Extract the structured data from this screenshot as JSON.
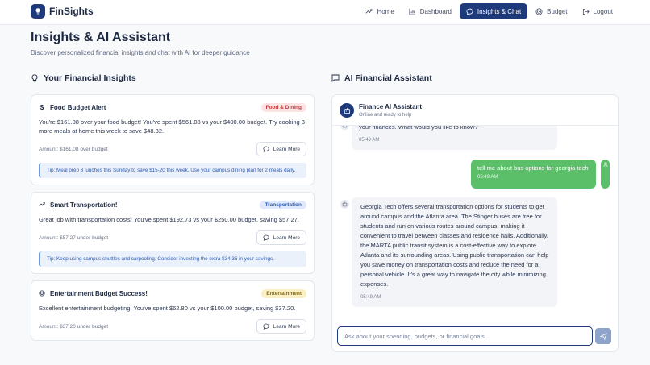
{
  "brand": {
    "name": "FinSights"
  },
  "nav": {
    "links": [
      {
        "label": "Home",
        "icon": "trend-up-icon"
      },
      {
        "label": "Dashboard",
        "icon": "bar-chart-icon"
      },
      {
        "label": "Insights & Chat",
        "icon": "chat-icon",
        "active": true
      },
      {
        "label": "Budget",
        "icon": "target-icon"
      },
      {
        "label": "Logout",
        "icon": "logout-icon"
      }
    ]
  },
  "header": {
    "title": "Insights & AI Assistant",
    "subtitle": "Discover personalized financial insights and chat with AI for deeper guidance"
  },
  "insights": {
    "title": "Your Financial Insights",
    "cards": [
      {
        "icon": "dollar-icon",
        "title": "Food Budget Alert",
        "badge": "Food & Dining",
        "badge_color": "#c23b3b",
        "text": "You're $161.08 over your food budget! You've spent $561.08 vs your $400.00 budget. Try cooking 3 more meals at home this week to save $48.32.",
        "amount": "Amount: $161.08 over budget",
        "action": "Learn More",
        "tip": "Tip: Meal prep 3 lunches this Sunday to save $15-20 this week. Use your campus dining plan for 2 meals daily."
      },
      {
        "icon": "trend-up-icon",
        "title": "Smart Transportation!",
        "badge": "Transportation",
        "badge_color": "#2f5cb3",
        "text": "Great job with transportation costs! You've spent $192.73 vs your $250.00 budget, saving $57.27.",
        "amount": "Amount: $57.27 under budget",
        "action": "Learn More",
        "tip": "Tip: Keep using campus shuttles and carpooling. Consider investing the extra $34.36 in your savings."
      },
      {
        "icon": "target-icon",
        "title": "Entertainment Budget Success!",
        "badge": "Entertainment",
        "badge_color": "#8a6b0c",
        "text": "Excellent entertainment budgeting! You've spent $62.80 vs your $100.00 budget, saving $37.20.",
        "amount": "Amount: $37.20 under budget",
        "action": "Learn More"
      }
    ]
  },
  "chat": {
    "title": "AI Financial Assistant",
    "assistant_name": "Finance AI Assistant",
    "status": "Online and ready to help",
    "messages": [
      {
        "role": "bot",
        "text": "your finances. What would you like to know?",
        "time": "05:49 AM"
      },
      {
        "role": "user",
        "text": "tell me about bus options for georgia tech",
        "time": "05:49 AM"
      },
      {
        "role": "bot",
        "text": "Georgia Tech offers several transportation options for students to get around campus and the Atlanta area. The Stinger buses are free for students and run on various routes around campus, making it convenient to travel between classes and residence halls. Additionally, the MARTA public transit system is a cost-effective way to explore Atlanta and its surrounding areas. Using public transportation can help you save money on transportation costs and reduce the need for a personal vehicle. It's a great way to navigate the city while minimizing expenses.",
        "time": "05:49 AM"
      }
    ],
    "input_placeholder": "Ask about your spending, budgets, or financial goals..."
  },
  "colors": {
    "brand": "#1f3a7a",
    "user_bubble": "#5bbf6a",
    "bot_bubble": "#f2f4f7"
  }
}
